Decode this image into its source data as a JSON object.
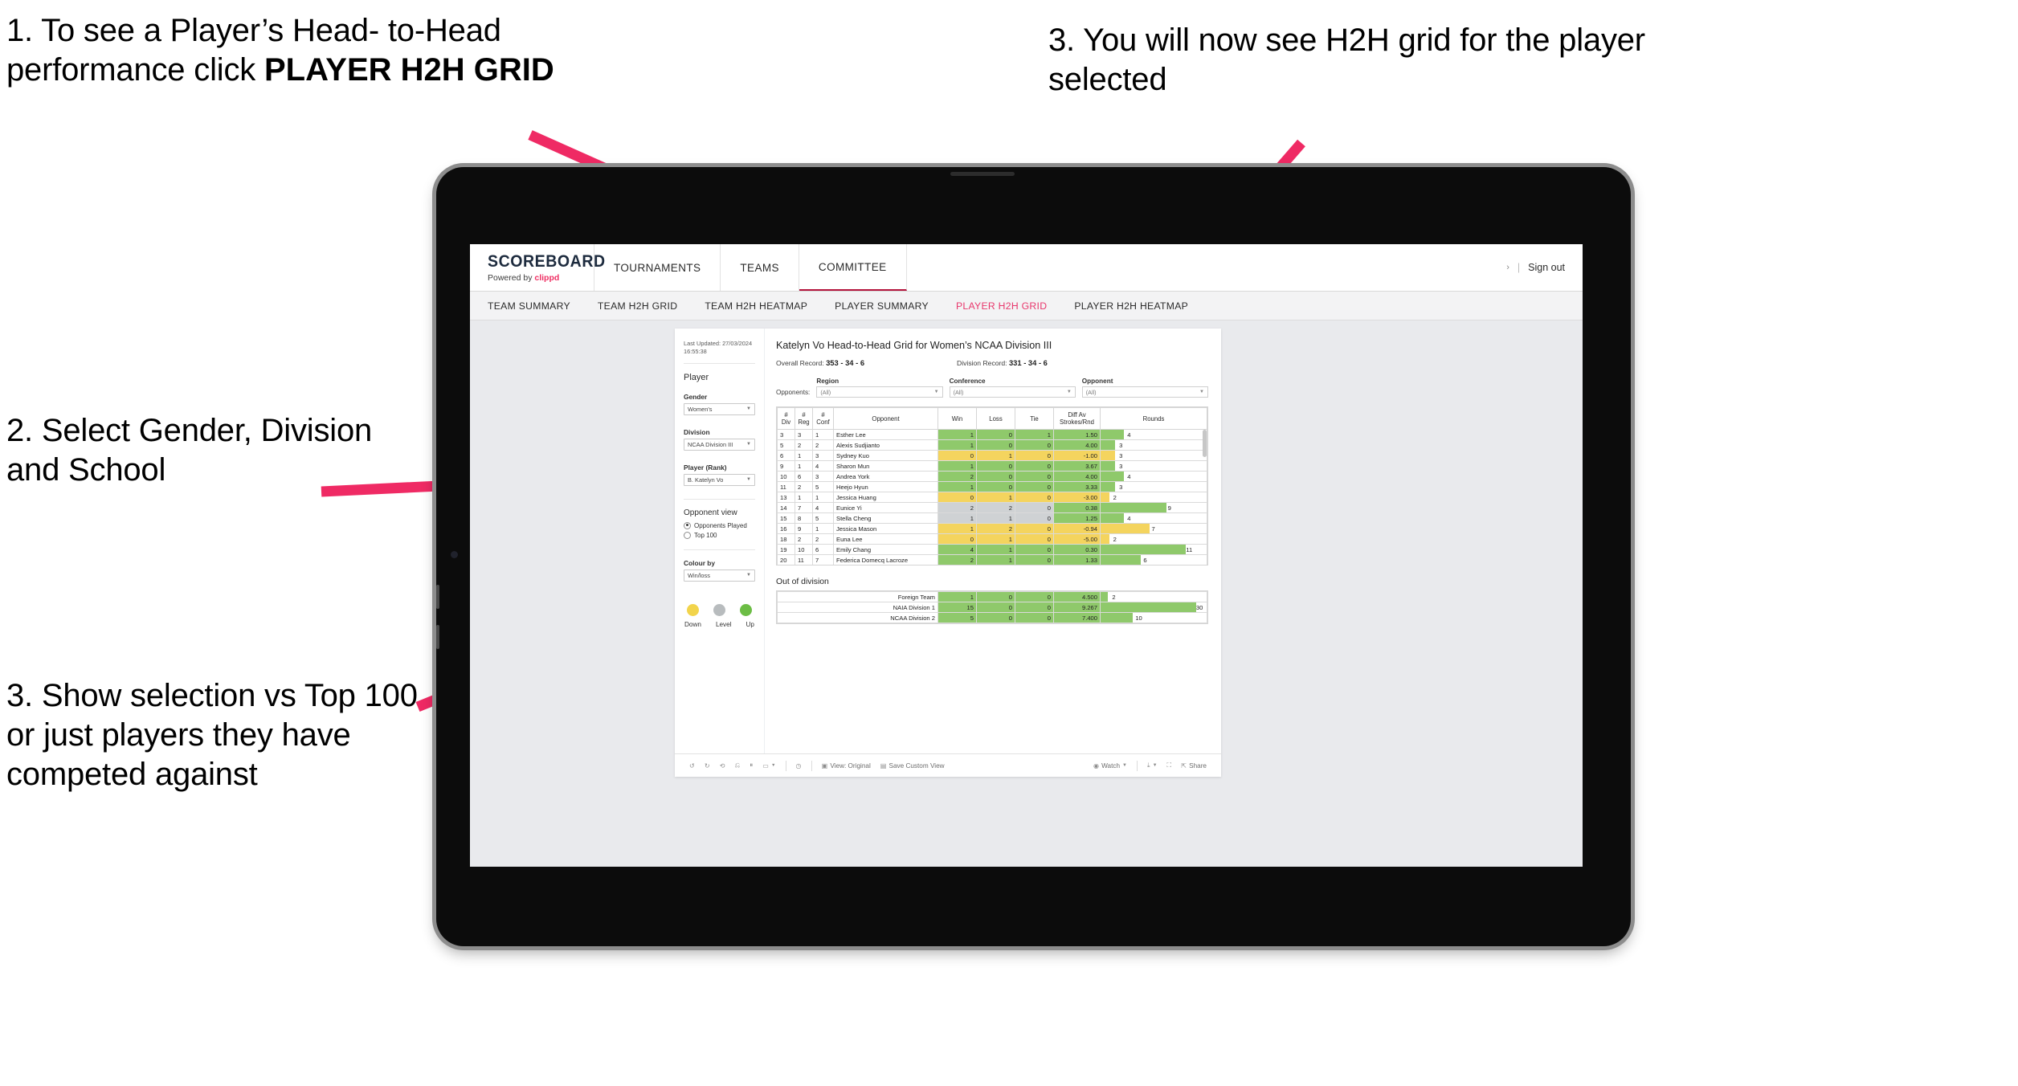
{
  "annotations": {
    "one_line1": "1. To see a Player’s Head-",
    "one_line2": "to-Head performance click ",
    "one_bold": "PLAYER H2H GRID",
    "two": "2. Select Gender, Division and School",
    "three": "3. Show selection vs Top 100 or just players they have competed against",
    "four": "3. You will now see H2H grid for the player selected",
    "arrow_color": "#ef2a64"
  },
  "app": {
    "brand": {
      "name": "SCOREBOARD",
      "powered_prefix": "Powered by ",
      "powered_brand": "clippd"
    },
    "topnav": [
      {
        "label": "TOURNAMENTS",
        "active": false
      },
      {
        "label": "TEAMS",
        "active": false
      },
      {
        "label": "COMMITTEE",
        "active": true
      }
    ],
    "topbar_right": {
      "chevron": "›",
      "separator": "|",
      "sign_out": "Sign out"
    },
    "subnav": [
      {
        "label": "TEAM SUMMARY",
        "active": false
      },
      {
        "label": "TEAM H2H GRID",
        "active": false
      },
      {
        "label": "TEAM H2H HEATMAP",
        "active": false
      },
      {
        "label": "PLAYER SUMMARY",
        "active": false
      },
      {
        "label": "PLAYER H2H GRID",
        "active": true
      },
      {
        "label": "PLAYER H2H HEATMAP",
        "active": false
      }
    ],
    "active_accent": "#e8376c"
  },
  "sidebar": {
    "last_updated": "Last Updated: 27/03/2024 16:55:38",
    "player_heading": "Player",
    "filters": [
      {
        "label": "Gender",
        "value": "Women's"
      },
      {
        "label": "Division",
        "value": "NCAA Division III"
      },
      {
        "label": "Player (Rank)",
        "value": "B. Katelyn Vo"
      }
    ],
    "opponent_view": {
      "heading": "Opponent view",
      "options": [
        {
          "label": "Opponents Played",
          "selected": true
        },
        {
          "label": "Top 100",
          "selected": false
        }
      ]
    },
    "colour_by": {
      "label": "Colour by",
      "value": "Win/loss"
    },
    "legend": [
      {
        "label": "Down",
        "color": "#f2d44b"
      },
      {
        "label": "Level",
        "color": "#b8bcbe"
      },
      {
        "label": "Up",
        "color": "#6cbd45"
      }
    ]
  },
  "main": {
    "title": "Katelyn Vo Head-to-Head Grid for Women’s NCAA Division III",
    "overall_record_label": "Overall Record: ",
    "overall_record_value": "353 - 34 - 6",
    "division_record_label": "Division Record: ",
    "division_record_value": "331 - 34 - 6",
    "opponents_label": "Opponents:",
    "opponent_filters": [
      {
        "label": "Region",
        "value": "(All)"
      },
      {
        "label": "Conference",
        "value": "(All)"
      },
      {
        "label": "Opponent",
        "value": "(All)"
      }
    ],
    "out_of_division_title": "Out of division"
  },
  "chart_data": {
    "type": "table",
    "title": "Katelyn Vo Head-to-Head Grid for Women’s NCAA Division III",
    "columns": [
      "# Div",
      "# Reg",
      "# Conf",
      "Opponent",
      "Win",
      "Loss",
      "Tie",
      "Diff Av Strokes/Rnd",
      "Rounds"
    ],
    "column_header_lines": [
      [
        "#",
        "Div"
      ],
      [
        "#",
        "Reg"
      ],
      [
        "#",
        "Conf"
      ],
      [
        "Opponent"
      ],
      [
        "Win"
      ],
      [
        "Loss"
      ],
      [
        "Tie"
      ],
      [
        "Diff Av",
        "Strokes/Rnd"
      ],
      [
        "Rounds"
      ]
    ],
    "rows": [
      {
        "div": "3",
        "reg": "3",
        "conf": "1",
        "opponent": "Esther Lee",
        "win": "1",
        "loss": "0",
        "tie": "1",
        "diff": "1.50",
        "rounds": "4",
        "color": "#8fc96b",
        "bar_pct": 22
      },
      {
        "div": "5",
        "reg": "2",
        "conf": "2",
        "opponent": "Alexis Sudjianto",
        "win": "1",
        "loss": "0",
        "tie": "0",
        "diff": "4.00",
        "rounds": "3",
        "color": "#8fc96b",
        "bar_pct": 14
      },
      {
        "div": "6",
        "reg": "1",
        "conf": "3",
        "opponent": "Sydney Kuo",
        "win": "0",
        "loss": "1",
        "tie": "0",
        "diff": "-1.00",
        "rounds": "3",
        "color": "#f4d45e",
        "bar_pct": 14
      },
      {
        "div": "9",
        "reg": "1",
        "conf": "4",
        "opponent": "Sharon Mun",
        "win": "1",
        "loss": "0",
        "tie": "0",
        "diff": "3.67",
        "rounds": "3",
        "color": "#8fc96b",
        "bar_pct": 14
      },
      {
        "div": "10",
        "reg": "6",
        "conf": "3",
        "opponent": "Andrea York",
        "win": "2",
        "loss": "0",
        "tie": "0",
        "diff": "4.00",
        "rounds": "4",
        "color": "#8fc96b",
        "bar_pct": 22
      },
      {
        "div": "11",
        "reg": "2",
        "conf": "5",
        "opponent": "Heejo Hyun",
        "win": "1",
        "loss": "0",
        "tie": "0",
        "diff": "3.33",
        "rounds": "3",
        "color": "#8fc96b",
        "bar_pct": 14
      },
      {
        "div": "13",
        "reg": "1",
        "conf": "1",
        "opponent": "Jessica Huang",
        "win": "0",
        "loss": "1",
        "tie": "0",
        "diff": "-3.00",
        "rounds": "2",
        "color": "#f4d45e",
        "bar_pct": 8
      },
      {
        "div": "14",
        "reg": "7",
        "conf": "4",
        "opponent": "Eunice Yi",
        "win": "2",
        "loss": "2",
        "tie": "0",
        "diff": "0.38",
        "rounds": "9",
        "color": "#cfd2d4",
        "bar_pct": 62,
        "diff_color": "#8fc96b"
      },
      {
        "div": "15",
        "reg": "8",
        "conf": "5",
        "opponent": "Stella Cheng",
        "win": "1",
        "loss": "1",
        "tie": "0",
        "diff": "1.25",
        "rounds": "4",
        "color": "#cfd2d4",
        "bar_pct": 22,
        "diff_color": "#8fc96b"
      },
      {
        "div": "16",
        "reg": "9",
        "conf": "1",
        "opponent": "Jessica Mason",
        "win": "1",
        "loss": "2",
        "tie": "0",
        "diff": "-0.94",
        "rounds": "7",
        "color": "#f4d45e",
        "bar_pct": 46
      },
      {
        "div": "18",
        "reg": "2",
        "conf": "2",
        "opponent": "Euna Lee",
        "win": "0",
        "loss": "1",
        "tie": "0",
        "diff": "-5.00",
        "rounds": "2",
        "color": "#f4d45e",
        "bar_pct": 8
      },
      {
        "div": "19",
        "reg": "10",
        "conf": "6",
        "opponent": "Emily Chang",
        "win": "4",
        "loss": "1",
        "tie": "0",
        "diff": "0.30",
        "rounds": "11",
        "color": "#8fc96b",
        "bar_pct": 80
      },
      {
        "div": "20",
        "reg": "11",
        "conf": "7",
        "opponent": "Federica Domecq Lacroze",
        "win": "2",
        "loss": "1",
        "tie": "0",
        "diff": "1.33",
        "rounds": "6",
        "color": "#8fc96b",
        "bar_pct": 38
      }
    ],
    "out_of_division_rows": [
      {
        "name": "Foreign Team",
        "win": "1",
        "loss": "0",
        "tie": "0",
        "diff": "4.500",
        "rounds": "2",
        "color": "#8fc96b",
        "bar_pct": 7
      },
      {
        "name": "NAIA Division 1",
        "win": "15",
        "loss": "0",
        "tie": "0",
        "diff": "9.267",
        "rounds": "30",
        "color": "#8fc96b",
        "bar_pct": 90
      },
      {
        "name": "NCAA Division 2",
        "win": "5",
        "loss": "0",
        "tie": "0",
        "diff": "7.400",
        "rounds": "10",
        "color": "#8fc96b",
        "bar_pct": 30
      }
    ],
    "legend": [
      {
        "label": "Down",
        "color": "#f2d44b"
      },
      {
        "label": "Level",
        "color": "#b8bcbe"
      },
      {
        "label": "Up",
        "color": "#6cbd45"
      }
    ]
  },
  "toolbar": {
    "view_label": "View: Original",
    "save_label": "Save Custom View",
    "watch_label": "Watch",
    "share_label": "Share",
    "caret": "▾"
  }
}
